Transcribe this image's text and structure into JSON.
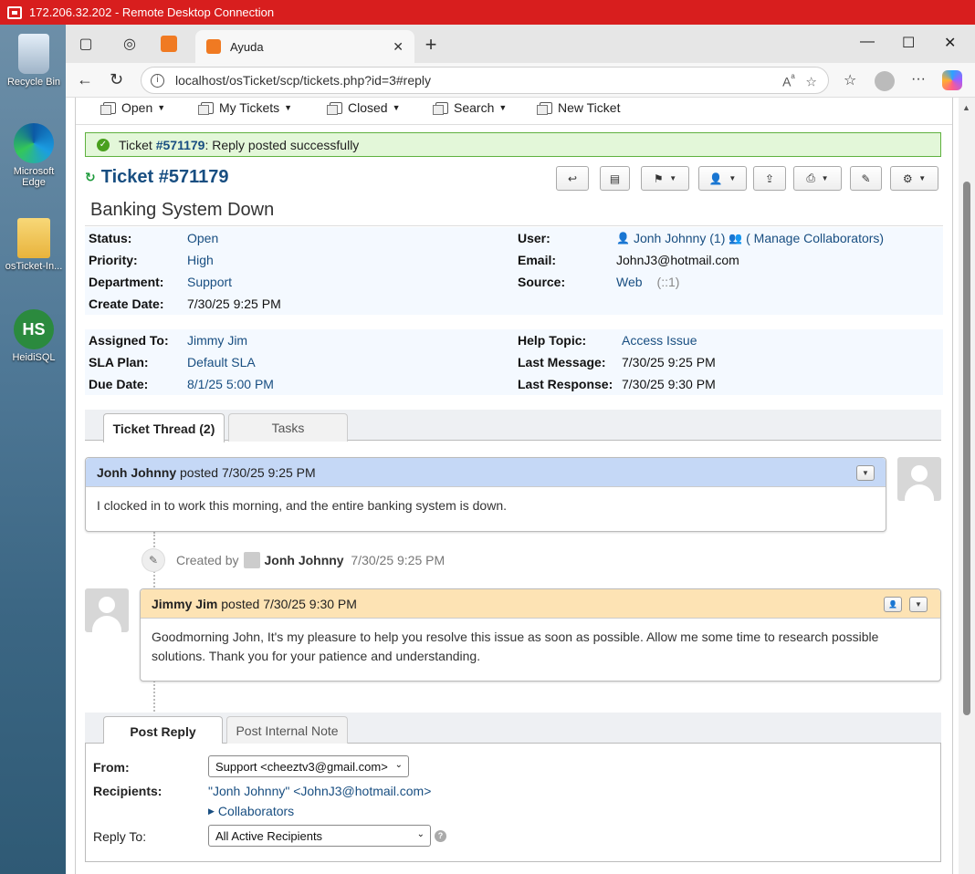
{
  "rdp": {
    "title": "172.206.32.202 - Remote Desktop Connection"
  },
  "desktop": {
    "icons": [
      {
        "label": "Recycle Bin"
      },
      {
        "label": "Microsoft Edge"
      },
      {
        "label": "osTicket-In..."
      },
      {
        "label": "HeidiSQL",
        "glyph": "HS"
      }
    ]
  },
  "browser": {
    "tab_title": "Ayuda",
    "url": "localhost/osTicket/scp/tickets.php?id=3#reply"
  },
  "subnav": {
    "open": "Open",
    "my_tickets": "My Tickets",
    "closed": "Closed",
    "search": "Search",
    "new_ticket": "New Ticket"
  },
  "alert": {
    "prefix": "Ticket ",
    "ticket_link": "#571179",
    "suffix": ": Reply posted successfully"
  },
  "ticket": {
    "title": "Ticket #571179",
    "subject": "Banking System Down",
    "status_label": "Status:",
    "status": "Open",
    "priority_label": "Priority:",
    "priority": "High",
    "department_label": "Department:",
    "department": "Support",
    "create_date_label": "Create Date:",
    "create_date": "7/30/25 9:25 PM",
    "user_label": "User:",
    "user": "Jonh Johnny",
    "user_count": "(1)",
    "manage_collaborators": "( Manage Collaborators)",
    "email_label": "Email:",
    "email": "JohnJ3@hotmail.com",
    "source_label": "Source:",
    "source": "Web",
    "source_ip": "(::1)",
    "assigned_label": "Assigned To:",
    "assigned": "Jimmy Jim",
    "sla_label": "SLA Plan:",
    "sla": "Default SLA",
    "due_label": "Due Date:",
    "due": "8/1/25 5:00 PM",
    "help_topic_label": "Help Topic:",
    "help_topic": "Access Issue",
    "last_message_label": "Last Message:",
    "last_message": "7/30/25 9:25 PM",
    "last_response_label": "Last Response:",
    "last_response": "7/30/25 9:30 PM"
  },
  "thread_tabs": {
    "thread": "Ticket Thread (2)",
    "tasks": "Tasks"
  },
  "thread": [
    {
      "author": "Jonh Johnny",
      "posted": " posted 7/30/25 9:25 PM",
      "body": "I clocked in to work this morning, and the entire banking system is down."
    },
    {
      "author": "Jimmy Jim",
      "posted": " posted 7/30/25 9:30 PM",
      "body": "Goodmorning John, It's my pleasure to help you resolve this issue as soon as possible. Allow me some time to research possible solutions. Thank you for your patience and understanding."
    }
  ],
  "event": {
    "created_by": "Created by",
    "author": "Jonh Johnny",
    "time": "7/30/25 9:25 PM"
  },
  "reply_tabs": {
    "post_reply": "Post Reply",
    "internal_note": "Post Internal Note"
  },
  "reply_form": {
    "from_label": "From:",
    "from_value": "Support <cheeztv3@gmail.com>",
    "recipients_label": "Recipients:",
    "recipients_value": "\"Jonh Johnny\" <JohnJ3@hotmail.com>",
    "collaborators": "Collaborators",
    "reply_to_label": "Reply To:",
    "reply_to_value": "All Active Recipients"
  }
}
